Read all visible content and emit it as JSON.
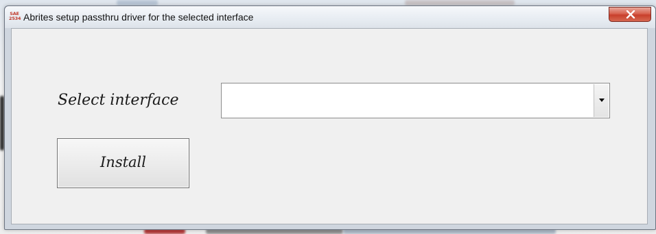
{
  "window": {
    "title": "Abrites setup passthru driver for the selected interface",
    "icon_text": "SAE\n2534",
    "icon_name": "sae-2534-icon"
  },
  "form": {
    "select_label": "Select interface",
    "select_value": "",
    "install_label": "Install"
  },
  "colors": {
    "close_button": "#c8402c",
    "client_bg": "#f0f0f0",
    "titlebar_bg": "#e7ecf2"
  }
}
